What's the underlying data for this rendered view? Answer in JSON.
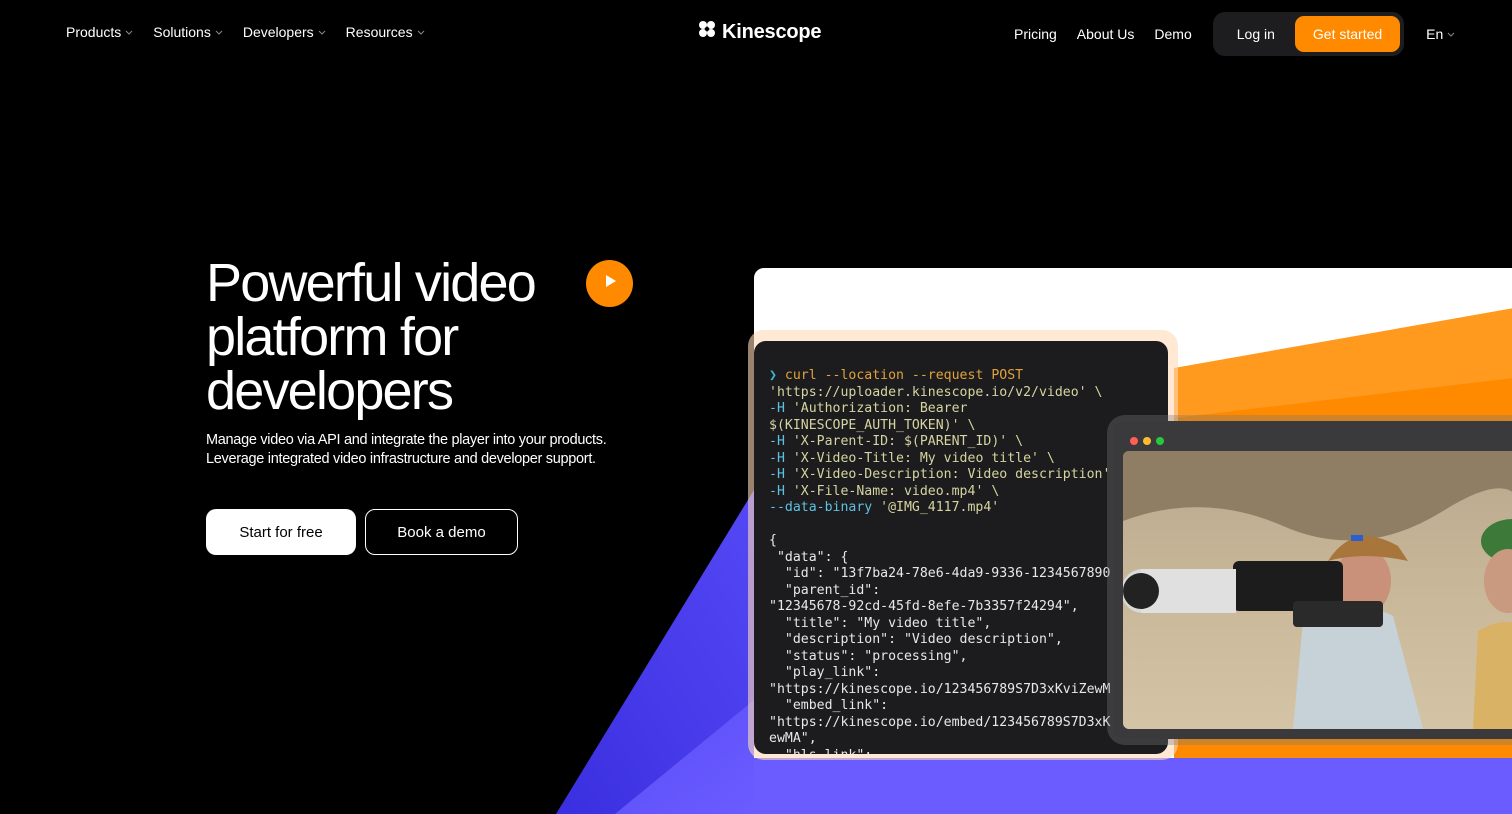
{
  "nav": {
    "left_items": [
      {
        "label": "Products"
      },
      {
        "label": "Solutions"
      },
      {
        "label": "Developers"
      },
      {
        "label": "Resources"
      }
    ],
    "logo_text": "Kinescope",
    "right_links": [
      {
        "label": "Pricing"
      },
      {
        "label": "About Us"
      },
      {
        "label": "Demo"
      }
    ],
    "login_label": "Log in",
    "cta_label": "Get started",
    "language": "En"
  },
  "hero": {
    "title_line1": "Powerful video",
    "title_line2": "platform for",
    "title_line3": "developers",
    "subtitle_line1": "Manage video via API and integrate the player into your products.",
    "subtitle_line2": "Leverage integrated video infrastructure and developer support.",
    "primary_button": "Start for free",
    "secondary_button": "Book a demo"
  },
  "terminal": {
    "prompt": "❯",
    "lines": [
      {
        "cmd": "curl --location --request POST"
      },
      {
        "str": "'https://uploader.kinescope.io/v2/video' \\"
      },
      {
        "flag": "-H",
        "str": " 'Authorization: Bearer"
      },
      {
        "str": "$(KINESCOPE_AUTH_TOKEN)' \\"
      },
      {
        "flag": "-H",
        "str": " 'X-Parent-ID: $(PARENT_ID)' \\"
      },
      {
        "flag": "-H",
        "str": " 'X-Video-Title: My video title' \\"
      },
      {
        "flag": "-H",
        "str": " 'X-Video-Description: Video description'"
      },
      {
        "flag": "-H",
        "str": " 'X-File-Name: video.mp4' \\"
      },
      {
        "flag": "--data-binary",
        "str": " '@IMG_4117.mp4'"
      }
    ],
    "response": [
      "{",
      " \"data\": {",
      "  \"id\": \"13f7ba24-78e6-4da9-9336-1234567890",
      "  \"parent_id\":",
      "\"12345678-92cd-45fd-8efe-7b3357f24294\",",
      "  \"title\": \"My video title\",",
      "  \"description\": \"Video description\",",
      "  \"status\": \"processing\",",
      "  \"play_link\":",
      "\"https://kinescope.io/123456789S7D3xKviZewM",
      "  \"embed_link\":",
      "\"https://kinescope.io/embed/123456789S7D3xK",
      "ewMA\",",
      "  \"hls_link\":"
    ]
  },
  "colors": {
    "accent_orange": "#ff8a00",
    "indigo": "#4a3cf0",
    "window_dot_red": "#ff5f57",
    "window_dot_yellow": "#febc2e",
    "window_dot_green": "#28c840"
  },
  "icons": {
    "play": "play-icon",
    "logo": "kinescope-logo-icon",
    "chevron": "chevron-down-icon"
  }
}
